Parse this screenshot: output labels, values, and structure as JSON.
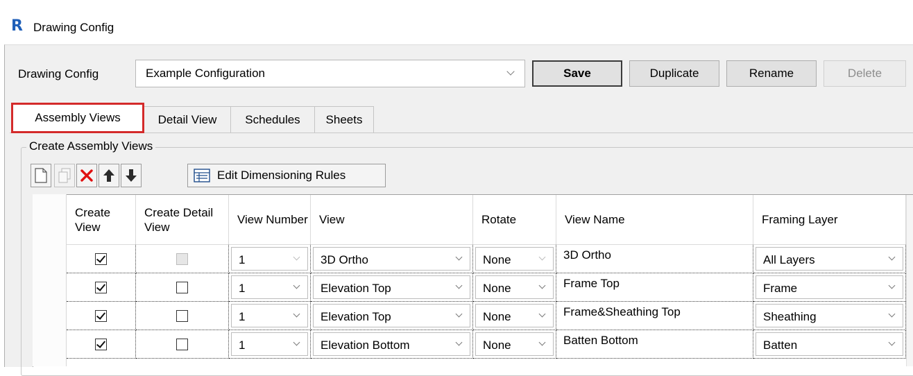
{
  "window": {
    "title": "Drawing Config",
    "logo_letter": "R"
  },
  "config": {
    "label": "Drawing Config",
    "selected": "Example Configuration",
    "buttons": {
      "save": "Save",
      "duplicate": "Duplicate",
      "rename": "Rename",
      "delete": "Delete"
    }
  },
  "tabs": [
    {
      "label": "Assembly Views",
      "active": true
    },
    {
      "label": "Detail View",
      "active": false
    },
    {
      "label": "Schedules",
      "active": false
    },
    {
      "label": "Sheets",
      "active": false
    }
  ],
  "group": {
    "title": "Create Assembly Views"
  },
  "toolbar": {
    "icons": [
      "new-icon",
      "copy-icon",
      "delete-x-icon",
      "move-up-icon",
      "move-down-icon",
      "dimension-rules-icon"
    ],
    "edit_rules_label": "Edit Dimensioning Rules"
  },
  "grid": {
    "headers": {
      "create_view": "Create View",
      "create_detail_view": "Create Detail View",
      "view_number": "View Number",
      "view": "View",
      "rotate": "Rotate",
      "view_name": "View Name",
      "framing_layer": "Framing Layer"
    },
    "rows": [
      {
        "create_view": true,
        "create_detail_view": false,
        "detail_disabled": true,
        "view_number": "1",
        "view": "3D Ortho",
        "rotate": "None",
        "view_name": "3D Ortho",
        "framing_layer": "All Layers"
      },
      {
        "create_view": true,
        "create_detail_view": false,
        "detail_disabled": false,
        "view_number": "1",
        "view": "Elevation Top",
        "rotate": "None",
        "view_name": "Frame Top",
        "framing_layer": "Frame"
      },
      {
        "create_view": true,
        "create_detail_view": false,
        "detail_disabled": false,
        "view_number": "1",
        "view": "Elevation Top",
        "rotate": "None",
        "view_name": "Frame&Sheathing Top",
        "framing_layer": "Sheathing"
      },
      {
        "create_view": true,
        "create_detail_view": false,
        "detail_disabled": false,
        "view_number": "1",
        "view": "Elevation Bottom",
        "rotate": "None",
        "view_name": "Batten Bottom",
        "framing_layer": "Batten"
      }
    ]
  },
  "colors": {
    "accent_red": "#d42a2a",
    "logo_blue": "#1f5fb8"
  }
}
